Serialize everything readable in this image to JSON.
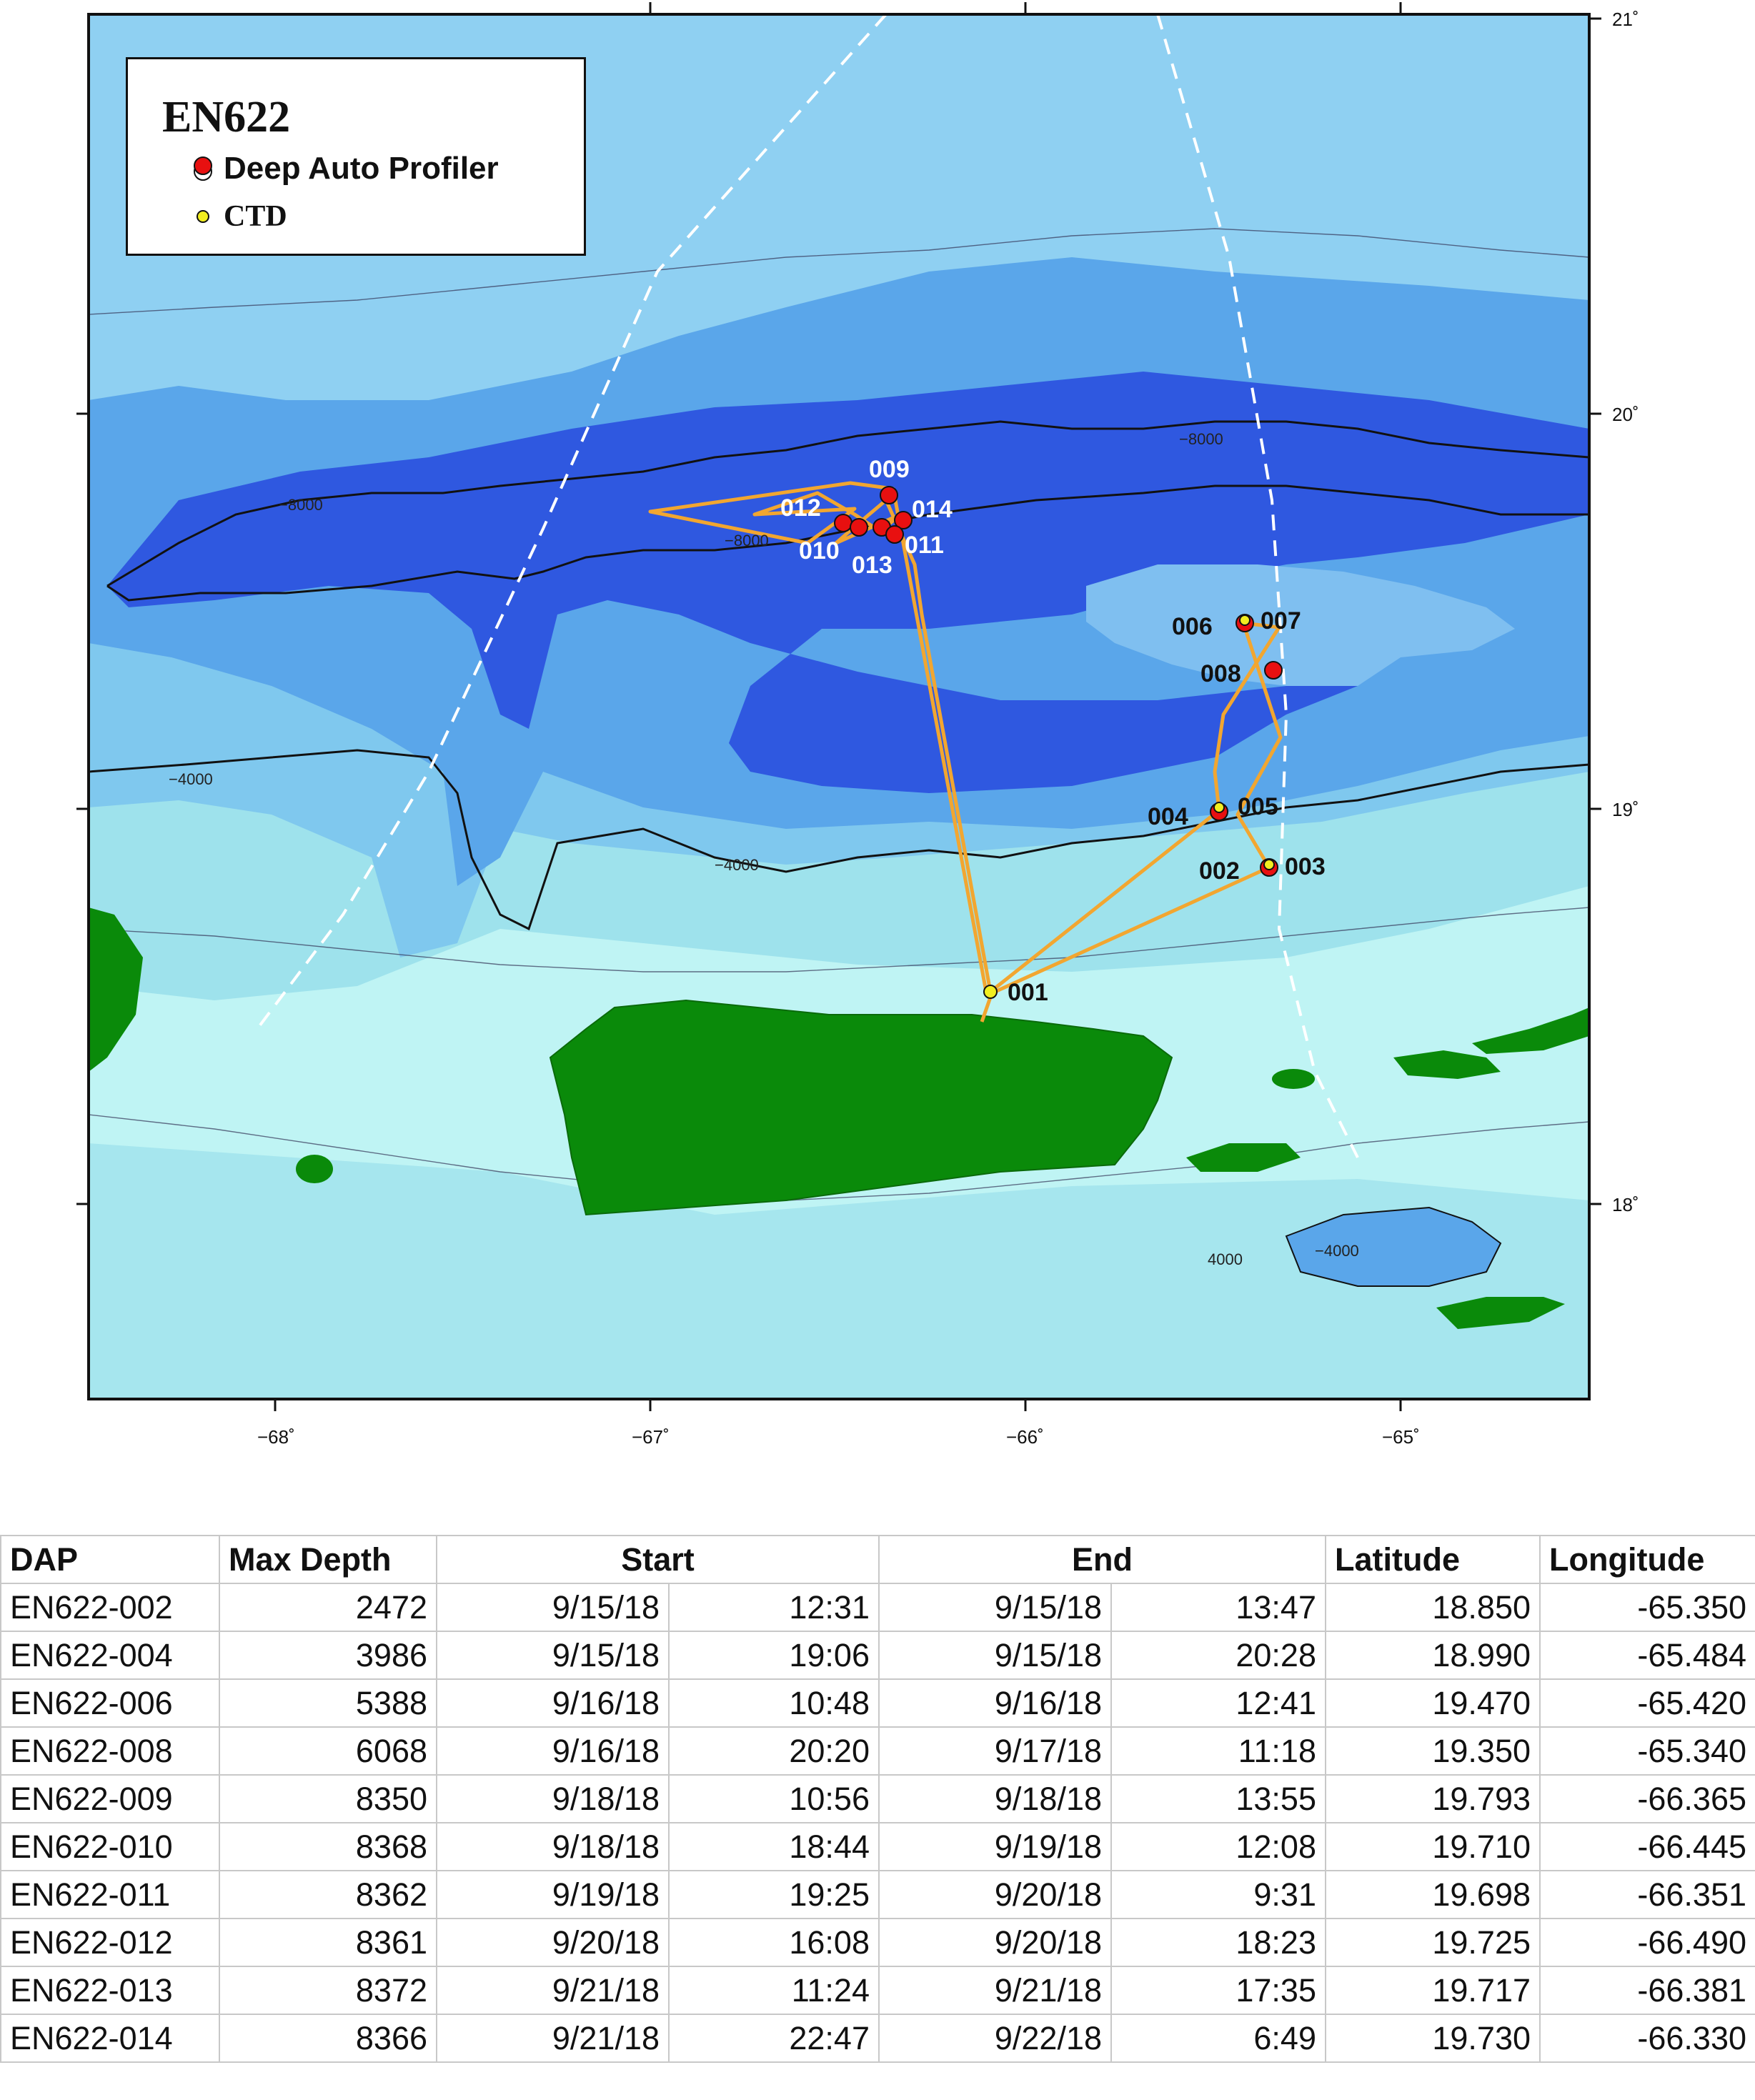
{
  "map": {
    "legend": {
      "title": "EN622",
      "items": [
        {
          "label": "Deep Auto Profiler",
          "symbol": "red-white-circle"
        },
        {
          "label": "CTD",
          "symbol": "yellow-circle"
        }
      ]
    },
    "lon_ticks": [
      "−68˚",
      "−67˚",
      "−66˚",
      "−65˚"
    ],
    "lat_ticks": [
      "21˚",
      "20˚",
      "19˚",
      "18˚"
    ],
    "contour_labels": [
      "−8000",
      "−8000",
      "−8000",
      "−4000",
      "−4000",
      "4000",
      "−4000"
    ],
    "stations": [
      "001",
      "002",
      "003",
      "004",
      "005",
      "006",
      "007",
      "008",
      "009",
      "010",
      "011",
      "012",
      "013",
      "014"
    ],
    "colors": {
      "shelf": "#bff4f4",
      "shallow": "#9ee2ec",
      "mid": "#7fc8ee",
      "deep": "#5aa6ea",
      "trench": "#2f58e0",
      "land": "#0a8a0a",
      "track": "#f2a630",
      "dap": "#e81010",
      "ctd": "#f2ee20"
    }
  },
  "table": {
    "headers": [
      "DAP",
      "Max Depth",
      "Start",
      "End",
      "Latitude",
      "Longitude"
    ],
    "rows": [
      [
        "EN622-002",
        "2472",
        "9/15/18",
        "12:31",
        "9/15/18",
        "13:47",
        "18.850",
        "-65.350"
      ],
      [
        "EN622-004",
        "3986",
        "9/15/18",
        "19:06",
        "9/15/18",
        "20:28",
        "18.990",
        "-65.484"
      ],
      [
        "EN622-006",
        "5388",
        "9/16/18",
        "10:48",
        "9/16/18",
        "12:41",
        "19.470",
        "-65.420"
      ],
      [
        "EN622-008",
        "6068",
        "9/16/18",
        "20:20",
        "9/17/18",
        "11:18",
        "19.350",
        "-65.340"
      ],
      [
        "EN622-009",
        "8350",
        "9/18/18",
        "10:56",
        "9/18/18",
        "13:55",
        "19.793",
        "-66.365"
      ],
      [
        "EN622-010",
        "8368",
        "9/18/18",
        "18:44",
        "9/19/18",
        "12:08",
        "19.710",
        "-66.445"
      ],
      [
        "EN622-011",
        "8362",
        "9/19/18",
        "19:25",
        "9/20/18",
        "9:31",
        "19.698",
        "-66.351"
      ],
      [
        "EN622-012",
        "8361",
        "9/20/18",
        "16:08",
        "9/20/18",
        "18:23",
        "19.725",
        "-66.490"
      ],
      [
        "EN622-013",
        "8372",
        "9/21/18",
        "11:24",
        "9/21/18",
        "17:35",
        "19.717",
        "-66.381"
      ],
      [
        "EN622-014",
        "8366",
        "9/21/18",
        "22:47",
        "9/22/18",
        "6:49",
        "19.730",
        "-66.330"
      ]
    ]
  }
}
